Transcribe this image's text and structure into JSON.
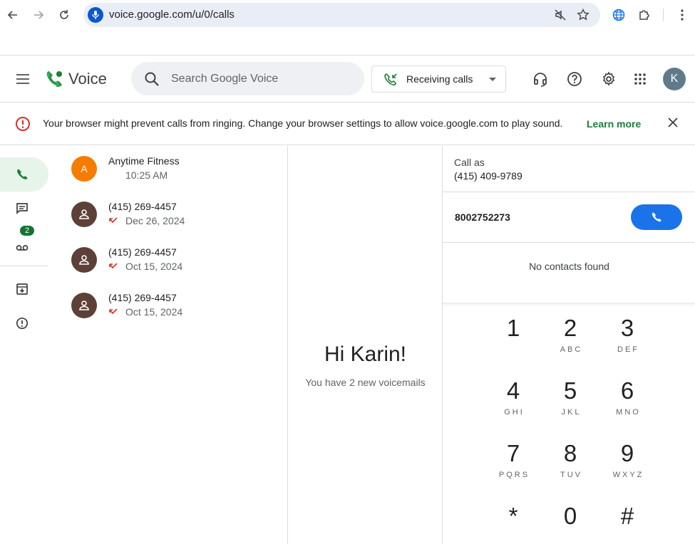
{
  "browser": {
    "url": "voice.google.com/u/0/calls"
  },
  "header": {
    "app_name": "Voice",
    "search_placeholder": "Search Google Voice",
    "receiving_label": "Receiving calls",
    "avatar_letter": "K"
  },
  "banner": {
    "text": "Your browser might prevent calls from ringing. Change your browser settings to allow voice.google.com to play sound.",
    "link": "Learn more"
  },
  "rail": {
    "voicemail_badge": "2"
  },
  "calls": [
    {
      "avatar": "A",
      "avatar_color": "#f57c00",
      "name": "Anytime Fitness",
      "meta": "10:25 AM",
      "missed": false
    },
    {
      "avatar": "",
      "avatar_color": "#5d4037",
      "name": "(415) 269-4457",
      "meta": "Dec 26, 2024",
      "missed": true
    },
    {
      "avatar": "",
      "avatar_color": "#5d4037",
      "name": "(415) 269-4457",
      "meta": "Oct 15, 2024",
      "missed": true
    },
    {
      "avatar": "",
      "avatar_color": "#5d4037",
      "name": "(415) 269-4457",
      "meta": "Oct 15, 2024",
      "missed": true
    }
  ],
  "greeting": {
    "title": "Hi Karin!",
    "subtitle": "You have 2 new voicemails"
  },
  "dialer": {
    "call_as_label": "Call as",
    "call_as_number": "(415) 409-9789",
    "input_value": "8002752273",
    "no_contacts": "No contacts found",
    "keys": [
      {
        "digit": "1",
        "letters": ""
      },
      {
        "digit": "2",
        "letters": "ABC"
      },
      {
        "digit": "3",
        "letters": "DEF"
      },
      {
        "digit": "4",
        "letters": "GHI"
      },
      {
        "digit": "5",
        "letters": "JKL"
      },
      {
        "digit": "6",
        "letters": "MNO"
      },
      {
        "digit": "7",
        "letters": "PQRS"
      },
      {
        "digit": "8",
        "letters": "TUV"
      },
      {
        "digit": "9",
        "letters": "WXYZ"
      },
      {
        "digit": "*",
        "letters": ""
      },
      {
        "digit": "0",
        "letters": ""
      },
      {
        "digit": "#",
        "letters": ""
      }
    ]
  },
  "colors": {
    "accent_green": "#188038",
    "call_blue": "#1a73e8",
    "missed_red": "#d93025"
  }
}
